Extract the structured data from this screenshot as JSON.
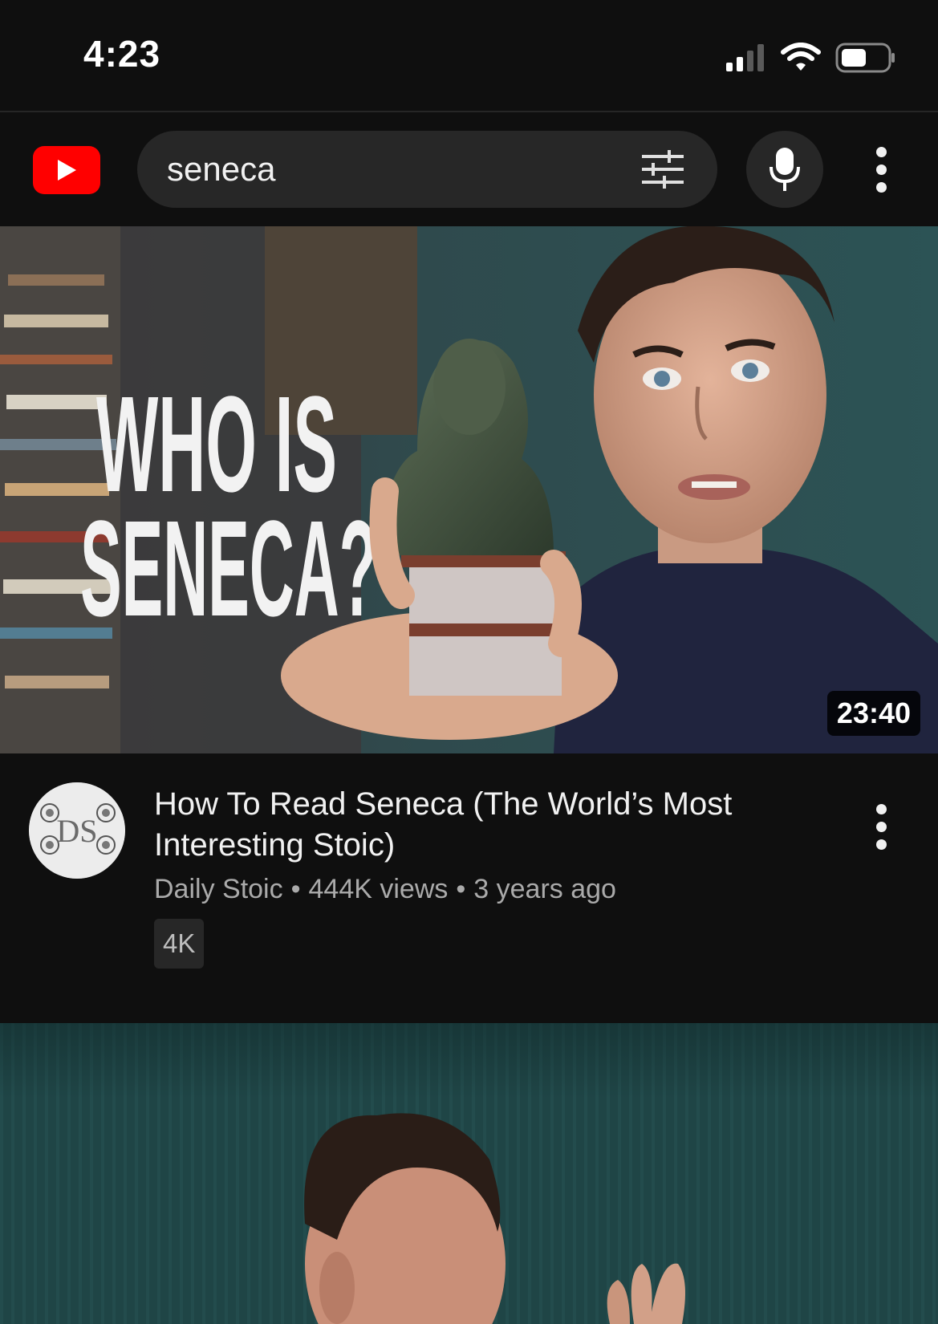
{
  "status_bar": {
    "time": "4:23",
    "icons": [
      "cellular-signal-icon",
      "wifi-icon",
      "battery-icon"
    ]
  },
  "search": {
    "logo": "youtube-logo-icon",
    "query": "seneca",
    "filter_icon": "filter-sliders-icon",
    "voice_icon": "microphone-icon",
    "more_icon": "more-vertical-icon"
  },
  "results": [
    {
      "thumbnail_text": "WHO IS SENECA?",
      "duration": "23:40",
      "title": "How To Read Seneca (The World’s Most Interesting Stoic)",
      "channel": "Daily Stoic",
      "separator": "•",
      "views": "444K views",
      "age": "3 years ago",
      "badge": "4K",
      "avatar_text": "DS"
    }
  ],
  "colors": {
    "background": "#0f0f0f",
    "surface": "#272727",
    "text_primary": "#f1f1f1",
    "text_secondary": "#aaaaaa",
    "brand_red": "#ff0000"
  }
}
